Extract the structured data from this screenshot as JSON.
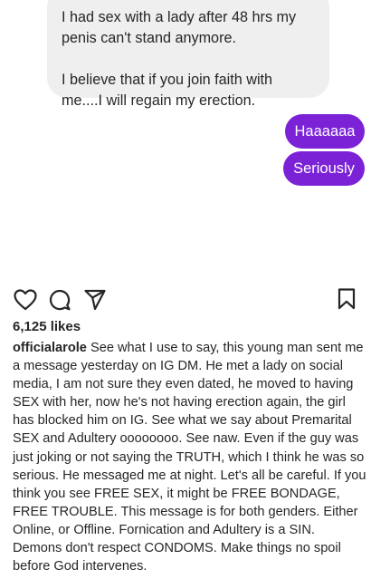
{
  "dm": {
    "incoming": {
      "paragraph1": "I had sex with a lady after 48 hrs my\npenis can't stand anymore.",
      "paragraph2": "I believe that if you join faith with\nme....I will regain my erection."
    },
    "outgoing": [
      {
        "text": "Haaaaaa"
      },
      {
        "text": "Seriously"
      }
    ],
    "colors": {
      "incoming_bg": "#efefef",
      "outgoing_bg": "#7b22d6"
    }
  },
  "post": {
    "icons": [
      "heart-icon",
      "comment-icon",
      "share-icon",
      "bookmark-icon"
    ],
    "likes": "6,125 likes",
    "username": "officialarole",
    "caption": "See what I use to say, this young man sent me a message yesterday on IG DM. He met a lady on social media, I am not sure they even dated, he moved to having SEX with her, now he's not having erection again, the girl has blocked him on IG. See what we say about Premarital SEX and Adultery oooooooo. See naw. Even if the guy was just joking or not saying the TRUTH, which I think he was so serious. He messaged me at night. Let's all be careful. If you think you see FREE SEX, it might be FREE BONDAGE, FREE TROUBLE. This message is for both genders. Either Online, or Offline. Fornication and Adultery is a SIN. Demons don't respect CONDOMS. Make things no spoil before God intervenes."
  }
}
